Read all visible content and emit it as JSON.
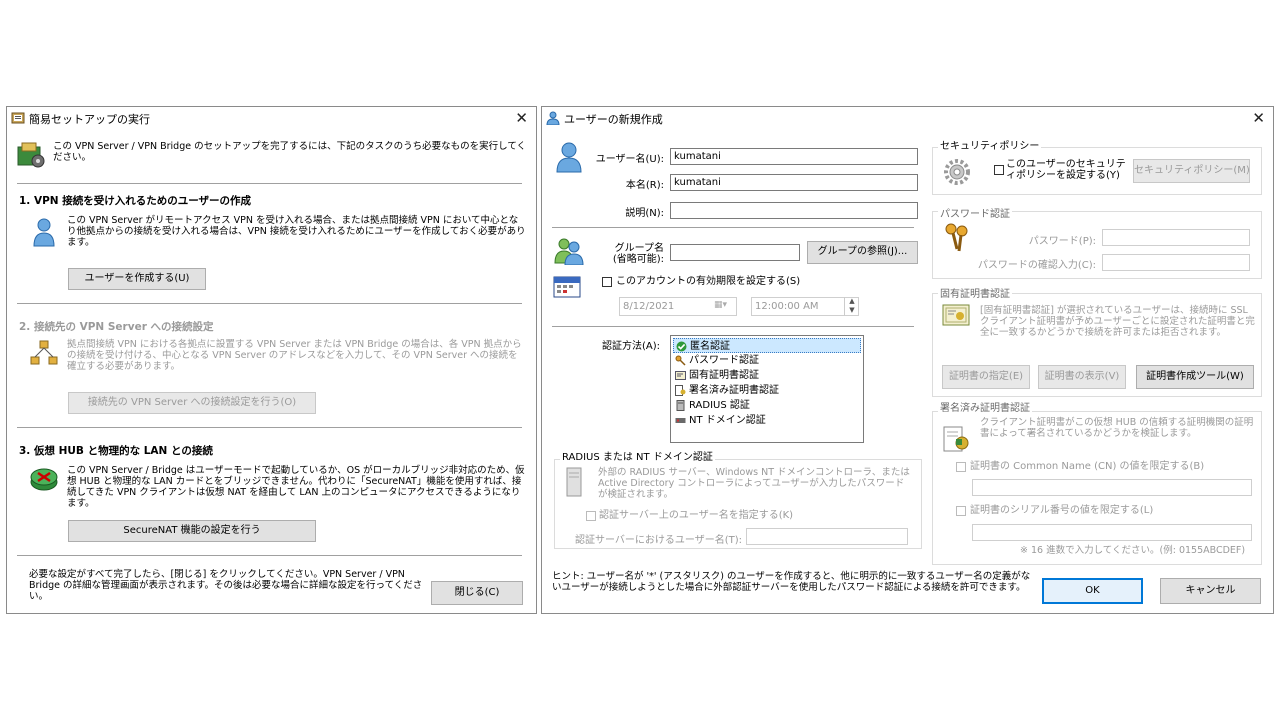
{
  "setup": {
    "title": "簡易セットアップの実行",
    "intro": "この VPN Server / VPN Bridge のセットアップを完了するには、下記のタスクのうち必要なものを実行してください。",
    "sec1": {
      "heading": "1. VPN 接続を受け入れるためのユーザーの作成",
      "desc": "この VPN Server がリモートアクセス VPN を受け入れる場合、または拠点間接続 VPN において中心となり他拠点からの接続を受け入れる場合は、VPN 接続を受け入れるためにユーザーを作成しておく必要があります。",
      "button": "ユーザーを作成する(U)"
    },
    "sec2": {
      "heading": "2. 接続先の VPN Server への接続設定",
      "desc": "拠点間接続 VPN における各拠点に設置する VPN Server または VPN Bridge の場合は、各 VPN 拠点からの接続を受け付ける、中心となる VPN Server のアドレスなどを入力して、その VPN Server への接続を確立する必要があります。",
      "button": "接続先の VPN Server への接続設定を行う(O)"
    },
    "sec3": {
      "heading": "3. 仮想 HUB と物理的な LAN との接続",
      "desc": "この VPN Server / Bridge はユーザーモードで起動しているか、OS がローカルブリッジ非対応のため、仮想 HUB と物理的な LAN カードとをブリッジできません。代わりに「SecureNAT」機能を使用すれば、接続してきた VPN クライアントは仮想 NAT を経由して LAN 上のコンピュータにアクセスできるようになります。",
      "button": "SecureNAT 機能の設定を行う"
    },
    "footer": "必要な設定がすべて完了したら、[閉じる] をクリックしてください。VPN Server / VPN Bridge の詳細な管理画面が表示されます。その後は必要な場合に詳細な設定を行ってください。",
    "close_button": "閉じる(C)"
  },
  "newuser": {
    "title": "ユーザーの新規作成",
    "username_label": "ユーザー名(U):",
    "username_value": "kumatani",
    "realname_label": "本名(R):",
    "realname_value": "kumatani",
    "note_label": "説明(N):",
    "note_value": "",
    "group_label": "グループ名\n(省略可能):",
    "group_value": "",
    "group_browse": "グループの参照(J)...",
    "expire_check": "このアカウントの有効期限を設定する(S)",
    "expire_date": "8/12/2021",
    "expire_time": "12:00:00 AM",
    "auth_label": "認証方法(A):",
    "auth_methods": [
      "匿名認証",
      "パスワード認証",
      "固有証明書認証",
      "署名済み証明書認証",
      "RADIUS 認証",
      "NT ドメイン認証"
    ],
    "auth_selected": "匿名認証",
    "radius": {
      "title": "RADIUS または NT ドメイン認証",
      "desc": "外部の RADIUS サーバー、Windows NT ドメインコントローラ、または Active Directory コントローラによってユーザーが入力したパスワードが検証されます。",
      "check": "認証サーバー上のユーザー名を指定する(K)",
      "username_label": "認証サーバーにおけるユーザー名(T):"
    },
    "policy": {
      "title": "セキュリティポリシー",
      "check": "このユーザーのセキュリティポリシーを設定する(Y)",
      "button": "セキュリティポリシー(M)"
    },
    "password": {
      "title": "パスワード認証",
      "password_label": "パスワード(P):",
      "confirm_label": "パスワードの確認入力(C):"
    },
    "cert": {
      "title": "固有証明書認証",
      "desc": "[固有証明書認証] が選択されているユーザーは、接続時に SSL クライアント証明書が予めユーザーごとに設定された証明書と完全に一致するかどうかで接続を許可または拒否されます。",
      "specify": "証明書の指定(E)",
      "view": "証明書の表示(V)",
      "tool": "証明書作成ツール(W)"
    },
    "signed": {
      "title": "署名済み証明書認証",
      "desc": "クライアント証明書がこの仮想 HUB の信頼する証明機関の証明書によって署名されているかどうかを検証します。",
      "cn_check": "証明書の Common Name (CN) の値を限定する(B)",
      "serial_check": "証明書のシリアル番号の値を限定する(L)",
      "hint": "※ 16 進数で入力してください。(例: 0155ABCDEF)"
    },
    "hint": "ヒント: ユーザー名が '*' (アスタリスク) のユーザーを作成すると、他に明示的に一致するユーザー名の定義がないユーザーが接続しようとした場合に外部認証サーバーを使用したパスワード認証による接続を許可できます。",
    "ok": "OK",
    "cancel": "キャンセル"
  }
}
